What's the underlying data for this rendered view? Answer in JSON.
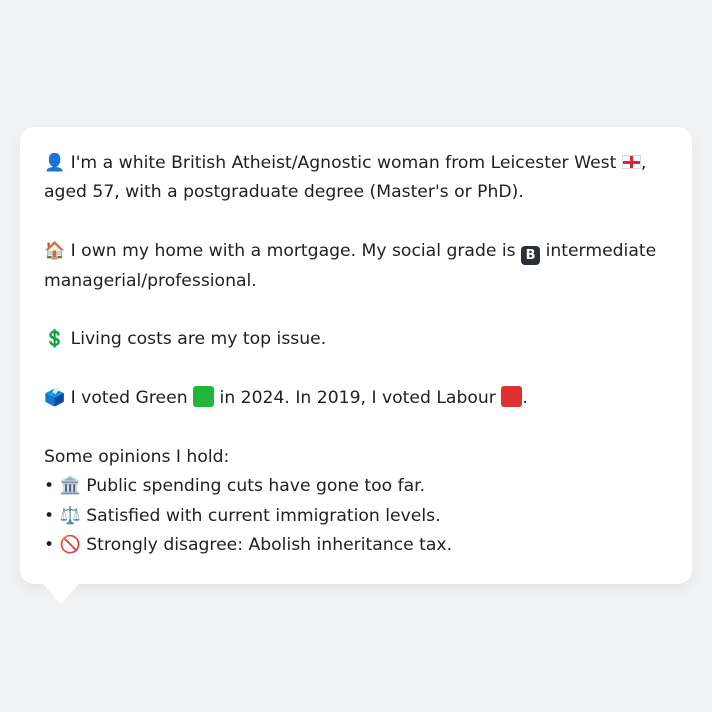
{
  "profile": {
    "identity_icon": "👤",
    "identity_text": "I'm a white British Atheist/Agnostic woman from Leicester West",
    "flag_icon": "england-flag-icon",
    "age_text": ", aged 57, with a postgraduate degree (Master's or PhD).",
    "home_icon": "🏠",
    "home_text": "I own my home with a mortgage. My social grade is",
    "grade_letter": "B",
    "grade_text": "intermediate managerial/professional.",
    "issue_icon": "💲",
    "issue_text": "Living costs are my top issue.",
    "vote_icon": "🗳️",
    "vote_text_1": "I voted Green",
    "vote_text_2": "in 2024. In 2019, I voted Labour",
    "vote_text_3": ".",
    "green_color": "#22b53c",
    "labour_color": "#e03030",
    "opinions_heading": "Some opinions I hold:",
    "opinions": [
      {
        "bullet": "•",
        "icon": "🏛️",
        "text": "Public spending cuts have gone too far."
      },
      {
        "bullet": "•",
        "icon": "⚖️",
        "text": "Satisfied with current immigration levels."
      },
      {
        "bullet": "•",
        "icon": "🚫",
        "text": "Strongly disagree: Abolish inheritance tax."
      }
    ]
  }
}
